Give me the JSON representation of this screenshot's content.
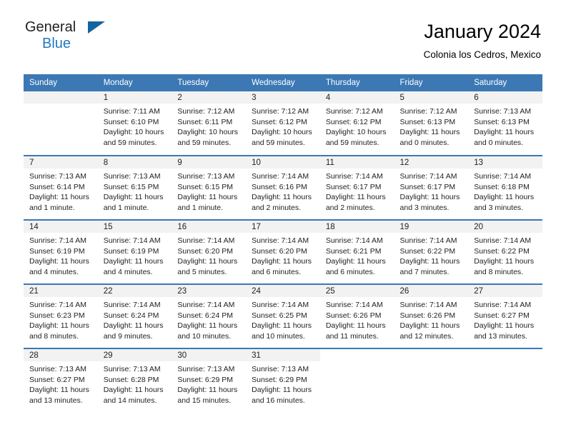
{
  "brand": {
    "name_top": "General",
    "name_bottom": "Blue",
    "triangle_color": "#15639f",
    "blue_color": "#2179bf"
  },
  "header": {
    "title": "January 2024",
    "subtitle": "Colonia los Cedros, Mexico",
    "header_bg": "#3b78b4",
    "band_bg": "#f2f2f2"
  },
  "weekday_headers": [
    "Sunday",
    "Monday",
    "Tuesday",
    "Wednesday",
    "Thursday",
    "Friday",
    "Saturday"
  ],
  "weeks": [
    [
      {
        "day": "",
        "lines": []
      },
      {
        "day": "1",
        "lines": [
          "Sunrise: 7:11 AM",
          "Sunset: 6:10 PM",
          "Daylight: 10 hours",
          "and 59 minutes."
        ]
      },
      {
        "day": "2",
        "lines": [
          "Sunrise: 7:12 AM",
          "Sunset: 6:11 PM",
          "Daylight: 10 hours",
          "and 59 minutes."
        ]
      },
      {
        "day": "3",
        "lines": [
          "Sunrise: 7:12 AM",
          "Sunset: 6:12 PM",
          "Daylight: 10 hours",
          "and 59 minutes."
        ]
      },
      {
        "day": "4",
        "lines": [
          "Sunrise: 7:12 AM",
          "Sunset: 6:12 PM",
          "Daylight: 10 hours",
          "and 59 minutes."
        ]
      },
      {
        "day": "5",
        "lines": [
          "Sunrise: 7:12 AM",
          "Sunset: 6:13 PM",
          "Daylight: 11 hours",
          "and 0 minutes."
        ]
      },
      {
        "day": "6",
        "lines": [
          "Sunrise: 7:13 AM",
          "Sunset: 6:13 PM",
          "Daylight: 11 hours",
          "and 0 minutes."
        ]
      }
    ],
    [
      {
        "day": "7",
        "lines": [
          "Sunrise: 7:13 AM",
          "Sunset: 6:14 PM",
          "Daylight: 11 hours",
          "and 1 minute."
        ]
      },
      {
        "day": "8",
        "lines": [
          "Sunrise: 7:13 AM",
          "Sunset: 6:15 PM",
          "Daylight: 11 hours",
          "and 1 minute."
        ]
      },
      {
        "day": "9",
        "lines": [
          "Sunrise: 7:13 AM",
          "Sunset: 6:15 PM",
          "Daylight: 11 hours",
          "and 1 minute."
        ]
      },
      {
        "day": "10",
        "lines": [
          "Sunrise: 7:14 AM",
          "Sunset: 6:16 PM",
          "Daylight: 11 hours",
          "and 2 minutes."
        ]
      },
      {
        "day": "11",
        "lines": [
          "Sunrise: 7:14 AM",
          "Sunset: 6:17 PM",
          "Daylight: 11 hours",
          "and 2 minutes."
        ]
      },
      {
        "day": "12",
        "lines": [
          "Sunrise: 7:14 AM",
          "Sunset: 6:17 PM",
          "Daylight: 11 hours",
          "and 3 minutes."
        ]
      },
      {
        "day": "13",
        "lines": [
          "Sunrise: 7:14 AM",
          "Sunset: 6:18 PM",
          "Daylight: 11 hours",
          "and 3 minutes."
        ]
      }
    ],
    [
      {
        "day": "14",
        "lines": [
          "Sunrise: 7:14 AM",
          "Sunset: 6:19 PM",
          "Daylight: 11 hours",
          "and 4 minutes."
        ]
      },
      {
        "day": "15",
        "lines": [
          "Sunrise: 7:14 AM",
          "Sunset: 6:19 PM",
          "Daylight: 11 hours",
          "and 4 minutes."
        ]
      },
      {
        "day": "16",
        "lines": [
          "Sunrise: 7:14 AM",
          "Sunset: 6:20 PM",
          "Daylight: 11 hours",
          "and 5 minutes."
        ]
      },
      {
        "day": "17",
        "lines": [
          "Sunrise: 7:14 AM",
          "Sunset: 6:20 PM",
          "Daylight: 11 hours",
          "and 6 minutes."
        ]
      },
      {
        "day": "18",
        "lines": [
          "Sunrise: 7:14 AM",
          "Sunset: 6:21 PM",
          "Daylight: 11 hours",
          "and 6 minutes."
        ]
      },
      {
        "day": "19",
        "lines": [
          "Sunrise: 7:14 AM",
          "Sunset: 6:22 PM",
          "Daylight: 11 hours",
          "and 7 minutes."
        ]
      },
      {
        "day": "20",
        "lines": [
          "Sunrise: 7:14 AM",
          "Sunset: 6:22 PM",
          "Daylight: 11 hours",
          "and 8 minutes."
        ]
      }
    ],
    [
      {
        "day": "21",
        "lines": [
          "Sunrise: 7:14 AM",
          "Sunset: 6:23 PM",
          "Daylight: 11 hours",
          "and 8 minutes."
        ]
      },
      {
        "day": "22",
        "lines": [
          "Sunrise: 7:14 AM",
          "Sunset: 6:24 PM",
          "Daylight: 11 hours",
          "and 9 minutes."
        ]
      },
      {
        "day": "23",
        "lines": [
          "Sunrise: 7:14 AM",
          "Sunset: 6:24 PM",
          "Daylight: 11 hours",
          "and 10 minutes."
        ]
      },
      {
        "day": "24",
        "lines": [
          "Sunrise: 7:14 AM",
          "Sunset: 6:25 PM",
          "Daylight: 11 hours",
          "and 10 minutes."
        ]
      },
      {
        "day": "25",
        "lines": [
          "Sunrise: 7:14 AM",
          "Sunset: 6:26 PM",
          "Daylight: 11 hours",
          "and 11 minutes."
        ]
      },
      {
        "day": "26",
        "lines": [
          "Sunrise: 7:14 AM",
          "Sunset: 6:26 PM",
          "Daylight: 11 hours",
          "and 12 minutes."
        ]
      },
      {
        "day": "27",
        "lines": [
          "Sunrise: 7:14 AM",
          "Sunset: 6:27 PM",
          "Daylight: 11 hours",
          "and 13 minutes."
        ]
      }
    ],
    [
      {
        "day": "28",
        "lines": [
          "Sunrise: 7:13 AM",
          "Sunset: 6:27 PM",
          "Daylight: 11 hours",
          "and 13 minutes."
        ]
      },
      {
        "day": "29",
        "lines": [
          "Sunrise: 7:13 AM",
          "Sunset: 6:28 PM",
          "Daylight: 11 hours",
          "and 14 minutes."
        ]
      },
      {
        "day": "30",
        "lines": [
          "Sunrise: 7:13 AM",
          "Sunset: 6:29 PM",
          "Daylight: 11 hours",
          "and 15 minutes."
        ]
      },
      {
        "day": "31",
        "lines": [
          "Sunrise: 7:13 AM",
          "Sunset: 6:29 PM",
          "Daylight: 11 hours",
          "and 16 minutes."
        ]
      },
      {
        "day": "",
        "lines": []
      },
      {
        "day": "",
        "lines": []
      },
      {
        "day": "",
        "lines": []
      }
    ]
  ]
}
